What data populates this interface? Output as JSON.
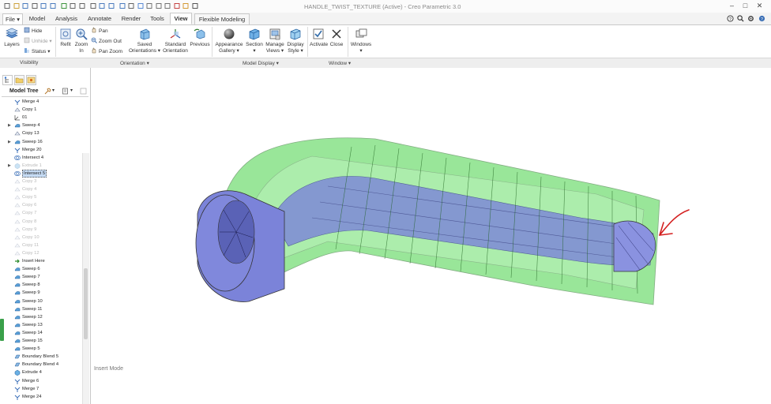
{
  "window": {
    "title": "HANDLE_TWIST_TEXTURE (Active) - Creo Parametric 3.0",
    "controls": [
      "–",
      "□",
      "✕"
    ]
  },
  "tabs": {
    "file": "File",
    "items": [
      "Model",
      "Analysis",
      "Annotate",
      "Render",
      "Tools",
      "View",
      "Flexible Modeling"
    ],
    "active": "View"
  },
  "ribbon": {
    "visibility": {
      "layers": "Layers",
      "hide": "Hide",
      "unhide": "Unhide",
      "status": "Status"
    },
    "orientation": {
      "refit": "Refit",
      "zoom_in_1": "Zoom",
      "zoom_in_2": "In",
      "pan": "Pan",
      "zoom_out": "Zoom Out",
      "pan_zoom": "Pan Zoom",
      "saved_1": "Saved",
      "saved_2": "Orientations",
      "standard_1": "Standard",
      "standard_2": "Orientation",
      "previous": "Previous"
    },
    "model_display": {
      "appearance_1": "Appearance",
      "appearance_2": "Gallery",
      "section": "Section",
      "manage_1": "Manage",
      "manage_2": "Views",
      "display_1": "Display",
      "display_2": "Style"
    },
    "window": {
      "activate": "Activate",
      "close": "Close",
      "windows": "Windows"
    },
    "groups": [
      "Visibility",
      "Orientation",
      "Model Display",
      "Window"
    ]
  },
  "model_tree": {
    "title": "Model Tree",
    "items": [
      {
        "label": "Merge 4",
        "icon": "merge-icon",
        "expand": "",
        "state": ""
      },
      {
        "label": "Copy 1",
        "icon": "copy-icon",
        "expand": "",
        "state": ""
      },
      {
        "label": "01",
        "icon": "csys-icon",
        "expand": "",
        "state": ""
      },
      {
        "label": "Sweep 4",
        "icon": "sweep-icon",
        "expand": "▶",
        "state": ""
      },
      {
        "label": "Copy 13",
        "icon": "copy-icon",
        "expand": "",
        "state": ""
      },
      {
        "label": "Sweep 16",
        "icon": "sweep-icon",
        "expand": "▶",
        "state": ""
      },
      {
        "label": "Merge 20",
        "icon": "merge-icon",
        "expand": "",
        "state": ""
      },
      {
        "label": "Intersect 4",
        "icon": "intersect-icon",
        "expand": "",
        "state": ""
      },
      {
        "label": "Extrude 1",
        "icon": "extrude-icon",
        "expand": "▶",
        "state": "supp"
      },
      {
        "label": "Intersect 5",
        "icon": "intersect-icon",
        "expand": "",
        "state": "sel"
      },
      {
        "label": "Copy 3",
        "icon": "copy-icon",
        "expand": "",
        "state": "supp"
      },
      {
        "label": "Copy 4",
        "icon": "copy-icon",
        "expand": "",
        "state": "supp"
      },
      {
        "label": "Copy 5",
        "icon": "copy-icon",
        "expand": "",
        "state": "supp"
      },
      {
        "label": "Copy 6",
        "icon": "copy-icon",
        "expand": "",
        "state": "supp"
      },
      {
        "label": "Copy 7",
        "icon": "copy-icon",
        "expand": "",
        "state": "supp"
      },
      {
        "label": "Copy 8",
        "icon": "copy-icon",
        "expand": "",
        "state": "supp"
      },
      {
        "label": "Copy 9",
        "icon": "copy-icon",
        "expand": "",
        "state": "supp"
      },
      {
        "label": "Copy 10",
        "icon": "copy-icon",
        "expand": "",
        "state": "supp"
      },
      {
        "label": "Copy 11",
        "icon": "copy-icon",
        "expand": "",
        "state": "supp"
      },
      {
        "label": "Copy 12",
        "icon": "copy-icon",
        "expand": "",
        "state": "supp"
      },
      {
        "label": "Insert Here",
        "icon": "insert-here-icon",
        "expand": "",
        "state": ""
      },
      {
        "label": "Sweep 6",
        "icon": "sweep-icon",
        "expand": "",
        "state": ""
      },
      {
        "label": "Sweep 7",
        "icon": "sweep-icon",
        "expand": "",
        "state": ""
      },
      {
        "label": "Sweep 8",
        "icon": "sweep-icon",
        "expand": "",
        "state": ""
      },
      {
        "label": "Sweep 9",
        "icon": "sweep-icon",
        "expand": "",
        "state": ""
      },
      {
        "label": "Sweep 10",
        "icon": "sweep-icon",
        "expand": "",
        "state": ""
      },
      {
        "label": "Sweep 11",
        "icon": "sweep-icon",
        "expand": "",
        "state": ""
      },
      {
        "label": "Sweep 12",
        "icon": "sweep-icon",
        "expand": "",
        "state": ""
      },
      {
        "label": "Sweep 13",
        "icon": "sweep-icon",
        "expand": "",
        "state": ""
      },
      {
        "label": "Sweep 14",
        "icon": "sweep-icon",
        "expand": "",
        "state": ""
      },
      {
        "label": "Sweep 15",
        "icon": "sweep-icon",
        "expand": "",
        "state": ""
      },
      {
        "label": "Sweep 5",
        "icon": "sweep-icon",
        "expand": "",
        "state": ""
      },
      {
        "label": "Boundary Blend 5",
        "icon": "boundary-blend-icon",
        "expand": "",
        "state": ""
      },
      {
        "label": "Boundary Blend 4",
        "icon": "boundary-blend-icon",
        "expand": "",
        "state": ""
      },
      {
        "label": "Extrude 4",
        "icon": "extrude-icon",
        "expand": "",
        "state": ""
      },
      {
        "label": "Merge 6",
        "icon": "merge-icon",
        "expand": "",
        "state": ""
      },
      {
        "label": "Merge 7",
        "icon": "merge-icon",
        "expand": "",
        "state": ""
      },
      {
        "label": "Merge 24",
        "icon": "merge-icon",
        "expand": "",
        "state": ""
      }
    ]
  },
  "status": {
    "mode": "Insert Mode"
  },
  "colors": {
    "model_green": "#3dcc3d",
    "model_blue": "#7b83d9",
    "annotation_arrow": "#d42020",
    "tree_selection": "#c6dcf5"
  }
}
